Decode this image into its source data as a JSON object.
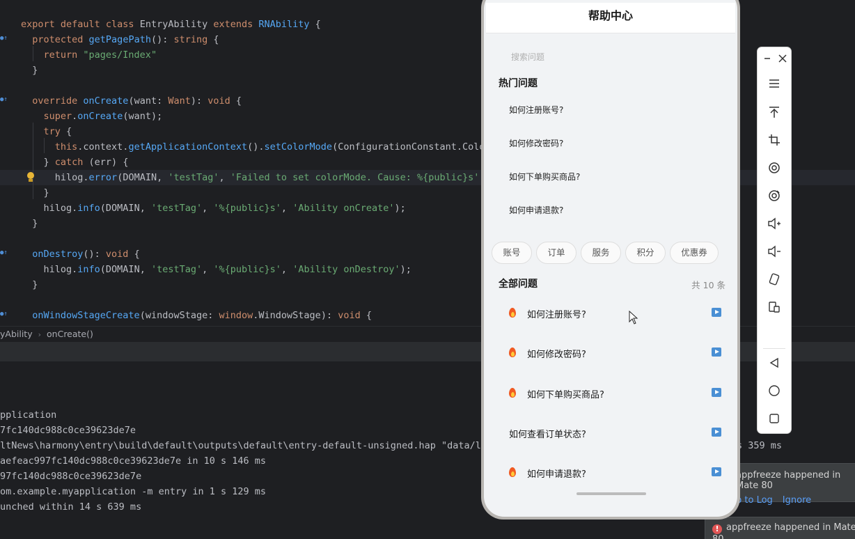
{
  "editor": {
    "lines": [
      {
        "segments": [
          [
            "kw",
            "export default class "
          ],
          [
            "pm",
            "EntryAbility "
          ],
          [
            "kw",
            "extends "
          ],
          [
            "fn",
            "RNAbility"
          ],
          [
            "pm",
            " {"
          ]
        ]
      },
      {
        "segments": [
          [
            "kw",
            "  protected "
          ],
          [
            "fn",
            "getPagePath"
          ],
          [
            "pm",
            "(): "
          ],
          [
            "kw",
            "string"
          ],
          [
            "pm",
            " {"
          ]
        ]
      },
      {
        "segments": [
          [
            "kw",
            "    return "
          ],
          [
            "str",
            "\"pages/Index\""
          ]
        ]
      },
      {
        "segments": [
          [
            "pm",
            "  }"
          ]
        ]
      },
      {
        "segments": [
          [
            "pm",
            ""
          ]
        ]
      },
      {
        "segments": [
          [
            "kw",
            "  override "
          ],
          [
            "fn",
            "onCreate"
          ],
          [
            "pm",
            "(want: "
          ],
          [
            "kw",
            "Want"
          ],
          [
            "pm",
            "): "
          ],
          [
            "kw",
            "void"
          ],
          [
            "pm",
            " {"
          ]
        ]
      },
      {
        "segments": [
          [
            "kw",
            "    super"
          ],
          [
            "pm",
            "."
          ],
          [
            "fn",
            "onCreate"
          ],
          [
            "pm",
            "(want);"
          ]
        ]
      },
      {
        "segments": [
          [
            "kw",
            "    try"
          ],
          [
            "pm",
            " {"
          ]
        ]
      },
      {
        "segments": [
          [
            "kw",
            "      this"
          ],
          [
            "pm",
            ".context."
          ],
          [
            "fn",
            "getApplicationContext"
          ],
          [
            "pm",
            "()."
          ],
          [
            "fn",
            "setColorMode"
          ],
          [
            "pm",
            "(ConfigurationConstant.Color"
          ]
        ]
      },
      {
        "segments": [
          [
            "pm",
            "    } "
          ],
          [
            "kw",
            "catch"
          ],
          [
            "pm",
            " (err) {"
          ]
        ]
      },
      {
        "segments": [
          [
            "pm",
            "      hilog."
          ],
          [
            "fn",
            "error"
          ],
          [
            "pm",
            "(DOMAIN, "
          ],
          [
            "str",
            "'testTag'"
          ],
          [
            "pm",
            ", "
          ],
          [
            "str",
            "'Failed to set colorMode. Cause: %{public}s'"
          ],
          [
            "pm",
            ","
          ]
        ]
      },
      {
        "segments": [
          [
            "pm",
            "    }"
          ]
        ]
      },
      {
        "segments": [
          [
            "pm",
            "    hilog."
          ],
          [
            "fn",
            "info"
          ],
          [
            "pm",
            "(DOMAIN, "
          ],
          [
            "str",
            "'testTag'"
          ],
          [
            "pm",
            ", "
          ],
          [
            "str",
            "'%{public}s'"
          ],
          [
            "pm",
            ", "
          ],
          [
            "str",
            "'Ability onCreate'"
          ],
          [
            "pm",
            ");"
          ]
        ]
      },
      {
        "segments": [
          [
            "pm",
            "  }"
          ]
        ]
      },
      {
        "segments": [
          [
            "pm",
            ""
          ]
        ]
      },
      {
        "segments": [
          [
            "fn",
            "  onDestroy"
          ],
          [
            "pm",
            "(): "
          ],
          [
            "kw",
            "void"
          ],
          [
            "pm",
            " {"
          ]
        ]
      },
      {
        "segments": [
          [
            "pm",
            "    hilog."
          ],
          [
            "fn",
            "info"
          ],
          [
            "pm",
            "(DOMAIN, "
          ],
          [
            "str",
            "'testTag'"
          ],
          [
            "pm",
            ", "
          ],
          [
            "str",
            "'%{public}s'"
          ],
          [
            "pm",
            ", "
          ],
          [
            "str",
            "'Ability onDestroy'"
          ],
          [
            "pm",
            ");"
          ]
        ]
      },
      {
        "segments": [
          [
            "pm",
            "  }"
          ]
        ]
      },
      {
        "segments": [
          [
            "pm",
            ""
          ]
        ]
      },
      {
        "segments": [
          [
            "fn",
            "  onWindowStageCreate"
          ],
          [
            "pm",
            "(windowStage: "
          ],
          [
            "kw",
            "window"
          ],
          [
            "pm",
            "."
          ],
          [
            "pm",
            "WindowStage"
          ],
          [
            "pm",
            "): "
          ],
          [
            "kw",
            "void"
          ],
          [
            "pm",
            " {"
          ]
        ]
      }
    ]
  },
  "breadcrumb": {
    "class": "yAbility",
    "method": "onCreate()"
  },
  "console": {
    "lines": [
      "pplication",
      "7fc140dc988c0ce39623de7e",
      "ltNews\\harmony\\entry\\build\\default\\outputs\\default\\entry-default-unsigned.hap \"data/loc",
      "aefeac997fc140dc988c0ce39623de7e in 10 s 146 ms",
      "97fc140dc988c0ce39623de7e",
      "om.example.myapplication -m entry in 1 s 129 ms",
      "unched within 14 s 639 ms"
    ],
    "tail_right": "s 359 ms"
  },
  "notifications": {
    "first": {
      "text": "appfreeze happened in Mate 80",
      "action1": "p to Log",
      "action2": "Ignore"
    },
    "second": {
      "text": "appfreeze happened in Mate 80"
    }
  },
  "phone": {
    "title": "帮助中心",
    "search_placeholder": "搜索问题",
    "hot_title": "热门问题",
    "hot_items": [
      "如何注册账号?",
      "如何修改密码?",
      "如何下单购买商品?",
      "如何申请退款?"
    ],
    "chips": [
      "账号",
      "订单",
      "服务",
      "积分",
      "优惠券"
    ],
    "all_title": "全部问题",
    "all_count": "共 10 条",
    "questions": [
      {
        "text": "如何注册账号?",
        "hot": true
      },
      {
        "text": "如何修改密码?",
        "hot": true
      },
      {
        "text": "如何下单购买商品?",
        "hot": true
      },
      {
        "text": "如何查看订单状态?",
        "hot": false
      },
      {
        "text": "如何申请退款?",
        "hot": true
      }
    ]
  },
  "toolbar": {
    "icons": [
      "minimize-icon",
      "close-icon",
      "menu-icon",
      "pin-top-icon",
      "crop-icon",
      "rotate-left-icon",
      "rotate-right-icon",
      "volume-up-icon",
      "volume-down-icon",
      "shake-icon",
      "screenshot-icon",
      "back-icon",
      "home-icon",
      "recents-icon"
    ]
  }
}
